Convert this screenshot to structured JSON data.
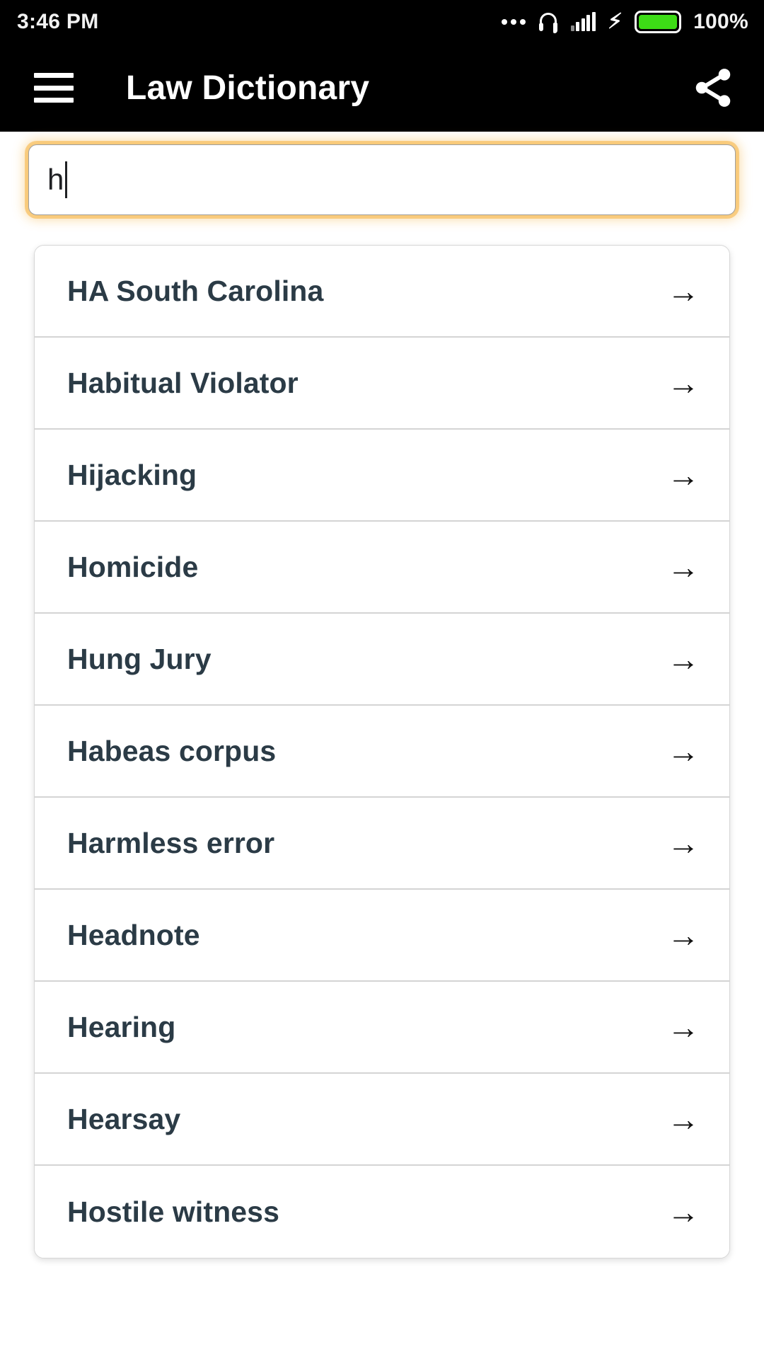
{
  "status_bar": {
    "time": "3:46 PM",
    "battery_percent": "100%",
    "battery_color": "#3ddc16",
    "icons": [
      "more-dots-icon",
      "headphone-icon",
      "signal-bars-icon",
      "charging-bolt-icon",
      "battery-icon"
    ]
  },
  "app_bar": {
    "menu_icon": "hamburger-menu-icon",
    "title": "Law Dictionary",
    "share_icon": "share-icon",
    "background_color": "#000000",
    "text_color": "#ffffff"
  },
  "search": {
    "value": "h",
    "placeholder": "",
    "focus_glow_color": "#f5b23f",
    "border_color": "#9e9e9e"
  },
  "results": {
    "arrow_glyph": "→",
    "text_color": "#2b3b46",
    "items": [
      {
        "label": "HA South Carolina"
      },
      {
        "label": "Habitual Violator"
      },
      {
        "label": "Hijacking"
      },
      {
        "label": "Homicide"
      },
      {
        "label": "Hung Jury"
      },
      {
        "label": "Habeas corpus"
      },
      {
        "label": "Harmless error"
      },
      {
        "label": "Headnote"
      },
      {
        "label": "Hearing"
      },
      {
        "label": "Hearsay"
      },
      {
        "label": "Hostile witness"
      }
    ]
  }
}
